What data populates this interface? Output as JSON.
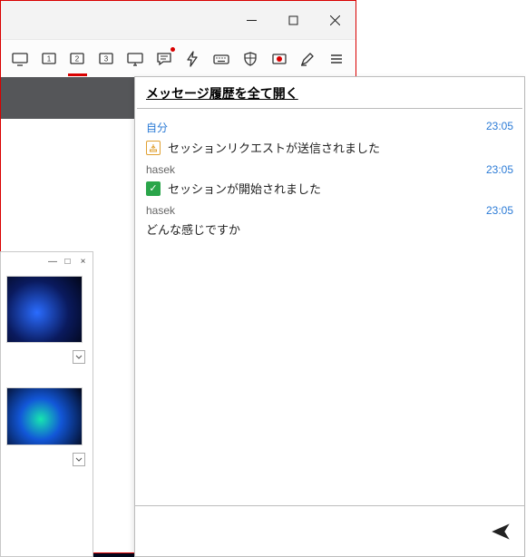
{
  "toolbar": {
    "items": [
      {
        "name": "monitor-all-icon"
      },
      {
        "name": "screen-1-icon"
      },
      {
        "name": "screen-2-icon"
      },
      {
        "name": "screen-3-icon"
      },
      {
        "name": "display-icon"
      },
      {
        "name": "chat-icon"
      },
      {
        "name": "flash-icon"
      },
      {
        "name": "keyboard-icon"
      },
      {
        "name": "shield-icon"
      },
      {
        "name": "record-icon"
      },
      {
        "name": "pen-icon"
      },
      {
        "name": "menu-icon"
      }
    ],
    "active_index": 2,
    "notify_index": 5
  },
  "chat": {
    "open_all_label": "メッセージ履歴を全て開く",
    "messages": [
      {
        "who": "自分",
        "who_self": true,
        "time": "23:05",
        "type": "request",
        "text": "セッションリクエストが送信されました"
      },
      {
        "who": "hasek",
        "who_self": false,
        "time": "23:05",
        "type": "started",
        "text": "セッションが開始されました"
      },
      {
        "who": "hasek",
        "who_self": false,
        "time": "23:05",
        "type": "plain",
        "text": "どんな感じですか"
      }
    ],
    "input_value": "",
    "input_placeholder": ""
  },
  "window_controls": {
    "min": "–",
    "max": "□",
    "close": "×"
  },
  "mini": {
    "controls": [
      "—",
      "□",
      "×"
    ]
  }
}
